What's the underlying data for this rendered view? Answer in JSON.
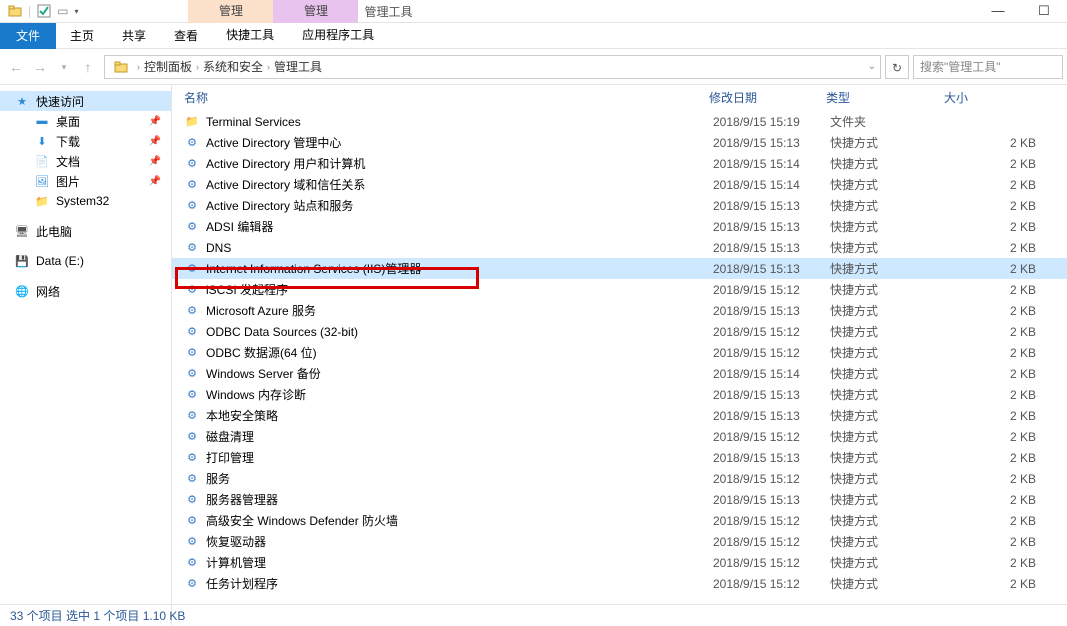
{
  "titlebar": {
    "ribbon_top": {
      "t1": "管理",
      "t2": "管理"
    },
    "window_title": "管理工具"
  },
  "ribbon": {
    "file": "文件",
    "tabs": [
      "主页",
      "共享",
      "查看",
      "快捷工具",
      "应用程序工具"
    ]
  },
  "breadcrumb": {
    "parts": [
      "控制面板",
      "系统和安全",
      "管理工具"
    ]
  },
  "search": {
    "placeholder": "搜索\"管理工具\""
  },
  "sidebar": {
    "quick_access": "快速访问",
    "items": [
      {
        "label": "桌面",
        "pin": true
      },
      {
        "label": "下载",
        "pin": true
      },
      {
        "label": "文档",
        "pin": true
      },
      {
        "label": "图片",
        "pin": true
      },
      {
        "label": "System32",
        "pin": false
      }
    ],
    "this_pc": "此电脑",
    "drive": "Data (E:)",
    "network": "网络"
  },
  "columns": {
    "name": "名称",
    "date": "修改日期",
    "type": "类型",
    "size": "大小"
  },
  "files": [
    {
      "name": "Terminal Services",
      "date": "2018/9/15 15:19",
      "type": "文件夹",
      "size": ""
    },
    {
      "name": "Active Directory 管理中心",
      "date": "2018/9/15 15:13",
      "type": "快捷方式",
      "size": "2 KB"
    },
    {
      "name": "Active Directory 用户和计算机",
      "date": "2018/9/15 15:14",
      "type": "快捷方式",
      "size": "2 KB"
    },
    {
      "name": "Active Directory 域和信任关系",
      "date": "2018/9/15 15:14",
      "type": "快捷方式",
      "size": "2 KB"
    },
    {
      "name": "Active Directory 站点和服务",
      "date": "2018/9/15 15:13",
      "type": "快捷方式",
      "size": "2 KB"
    },
    {
      "name": "ADSI 编辑器",
      "date": "2018/9/15 15:13",
      "type": "快捷方式",
      "size": "2 KB"
    },
    {
      "name": "DNS",
      "date": "2018/9/15 15:13",
      "type": "快捷方式",
      "size": "2 KB"
    },
    {
      "name": "Internet Information Services (IIS)管理器",
      "date": "2018/9/15 15:13",
      "type": "快捷方式",
      "size": "2 KB",
      "selected": true
    },
    {
      "name": "iSCSI 发起程序",
      "date": "2018/9/15 15:12",
      "type": "快捷方式",
      "size": "2 KB"
    },
    {
      "name": "Microsoft Azure 服务",
      "date": "2018/9/15 15:13",
      "type": "快捷方式",
      "size": "2 KB"
    },
    {
      "name": "ODBC Data Sources (32-bit)",
      "date": "2018/9/15 15:12",
      "type": "快捷方式",
      "size": "2 KB"
    },
    {
      "name": "ODBC 数据源(64 位)",
      "date": "2018/9/15 15:12",
      "type": "快捷方式",
      "size": "2 KB"
    },
    {
      "name": "Windows Server 备份",
      "date": "2018/9/15 15:14",
      "type": "快捷方式",
      "size": "2 KB"
    },
    {
      "name": "Windows 内存诊断",
      "date": "2018/9/15 15:13",
      "type": "快捷方式",
      "size": "2 KB"
    },
    {
      "name": "本地安全策略",
      "date": "2018/9/15 15:13",
      "type": "快捷方式",
      "size": "2 KB"
    },
    {
      "name": "磁盘清理",
      "date": "2018/9/15 15:12",
      "type": "快捷方式",
      "size": "2 KB"
    },
    {
      "name": "打印管理",
      "date": "2018/9/15 15:13",
      "type": "快捷方式",
      "size": "2 KB"
    },
    {
      "name": "服务",
      "date": "2018/9/15 15:12",
      "type": "快捷方式",
      "size": "2 KB"
    },
    {
      "name": "服务器管理器",
      "date": "2018/9/15 15:13",
      "type": "快捷方式",
      "size": "2 KB"
    },
    {
      "name": "高级安全 Windows Defender 防火墙",
      "date": "2018/9/15 15:12",
      "type": "快捷方式",
      "size": "2 KB"
    },
    {
      "name": "恢复驱动器",
      "date": "2018/9/15 15:12",
      "type": "快捷方式",
      "size": "2 KB"
    },
    {
      "name": "计算机管理",
      "date": "2018/9/15 15:12",
      "type": "快捷方式",
      "size": "2 KB"
    },
    {
      "name": "任务计划程序",
      "date": "2018/9/15 15:12",
      "type": "快捷方式",
      "size": "2 KB"
    }
  ],
  "statusbar": "33 个项目    选中 1 个项目   1.10 KB"
}
